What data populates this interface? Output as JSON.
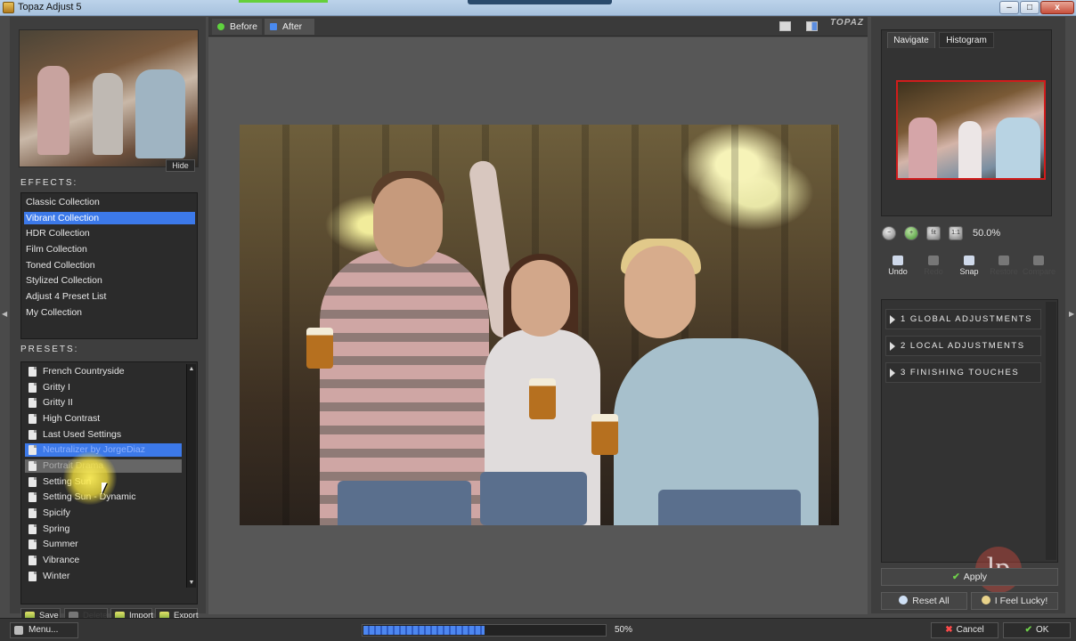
{
  "window": {
    "title": "Topaz Adjust 5"
  },
  "thumbnail": {
    "hide_label": "Hide"
  },
  "effects": {
    "label": "EFFECTS:",
    "items": [
      {
        "label": "Classic Collection",
        "selected": false
      },
      {
        "label": "Vibrant Collection",
        "selected": true
      },
      {
        "label": "HDR Collection",
        "selected": false
      },
      {
        "label": "Film Collection",
        "selected": false
      },
      {
        "label": "Toned Collection",
        "selected": false
      },
      {
        "label": "Stylized Collection",
        "selected": false
      },
      {
        "label": "Adjust 4 Preset List",
        "selected": false
      },
      {
        "label": "My Collection",
        "selected": false
      }
    ]
  },
  "presets": {
    "label": "PRESETS:",
    "items": [
      {
        "label": "French Countryside",
        "state": "normal"
      },
      {
        "label": "Gritty I",
        "state": "normal"
      },
      {
        "label": "Gritty II",
        "state": "normal"
      },
      {
        "label": "High Contrast",
        "state": "normal"
      },
      {
        "label": "Last Used Settings",
        "state": "normal"
      },
      {
        "label": "Neutralizer by JorgeDiaz",
        "state": "selected"
      },
      {
        "label": "Portrait Drama",
        "state": "hover"
      },
      {
        "label": "Setting Sun",
        "state": "normal"
      },
      {
        "label": "Setting Sun - Dynamic",
        "state": "normal"
      },
      {
        "label": "Spicify",
        "state": "normal"
      },
      {
        "label": "Spring",
        "state": "normal"
      },
      {
        "label": "Summer",
        "state": "normal"
      },
      {
        "label": "Vibrance",
        "state": "normal"
      },
      {
        "label": "Winter",
        "state": "normal"
      }
    ]
  },
  "preset_actions": {
    "save": "Save",
    "delete": "Delete",
    "import": "Import",
    "export": "Export"
  },
  "view_tabs": {
    "before": "Before",
    "after": "After"
  },
  "brand_logo": "TOPAZ",
  "navigator": {
    "tabs": [
      "Navigate",
      "Histogram"
    ],
    "zoom_level": "50.0%"
  },
  "history": {
    "undo": "Undo",
    "redo": "Redo",
    "snap": "Snap",
    "restore": "Restore",
    "compare": "Compare"
  },
  "adjustments": {
    "sections": [
      "1 GLOBAL ADJUSTMENTS",
      "2 LOCAL ADJUSTMENTS",
      "3 FINISHING TOUCHES"
    ]
  },
  "actions": {
    "apply": "Apply",
    "reset_all": "Reset All",
    "feel_lucky": "I Feel Lucky!"
  },
  "statusbar": {
    "menu": "Menu...",
    "progress_value": 0.5,
    "progress_label": "50%",
    "cancel": "Cancel",
    "ok": "OK"
  },
  "watermark": "lp",
  "colors": {
    "selection": "#3c79e9",
    "highlight_preview_border": "#d11c1c",
    "progress_fill": "#4d87f0"
  }
}
